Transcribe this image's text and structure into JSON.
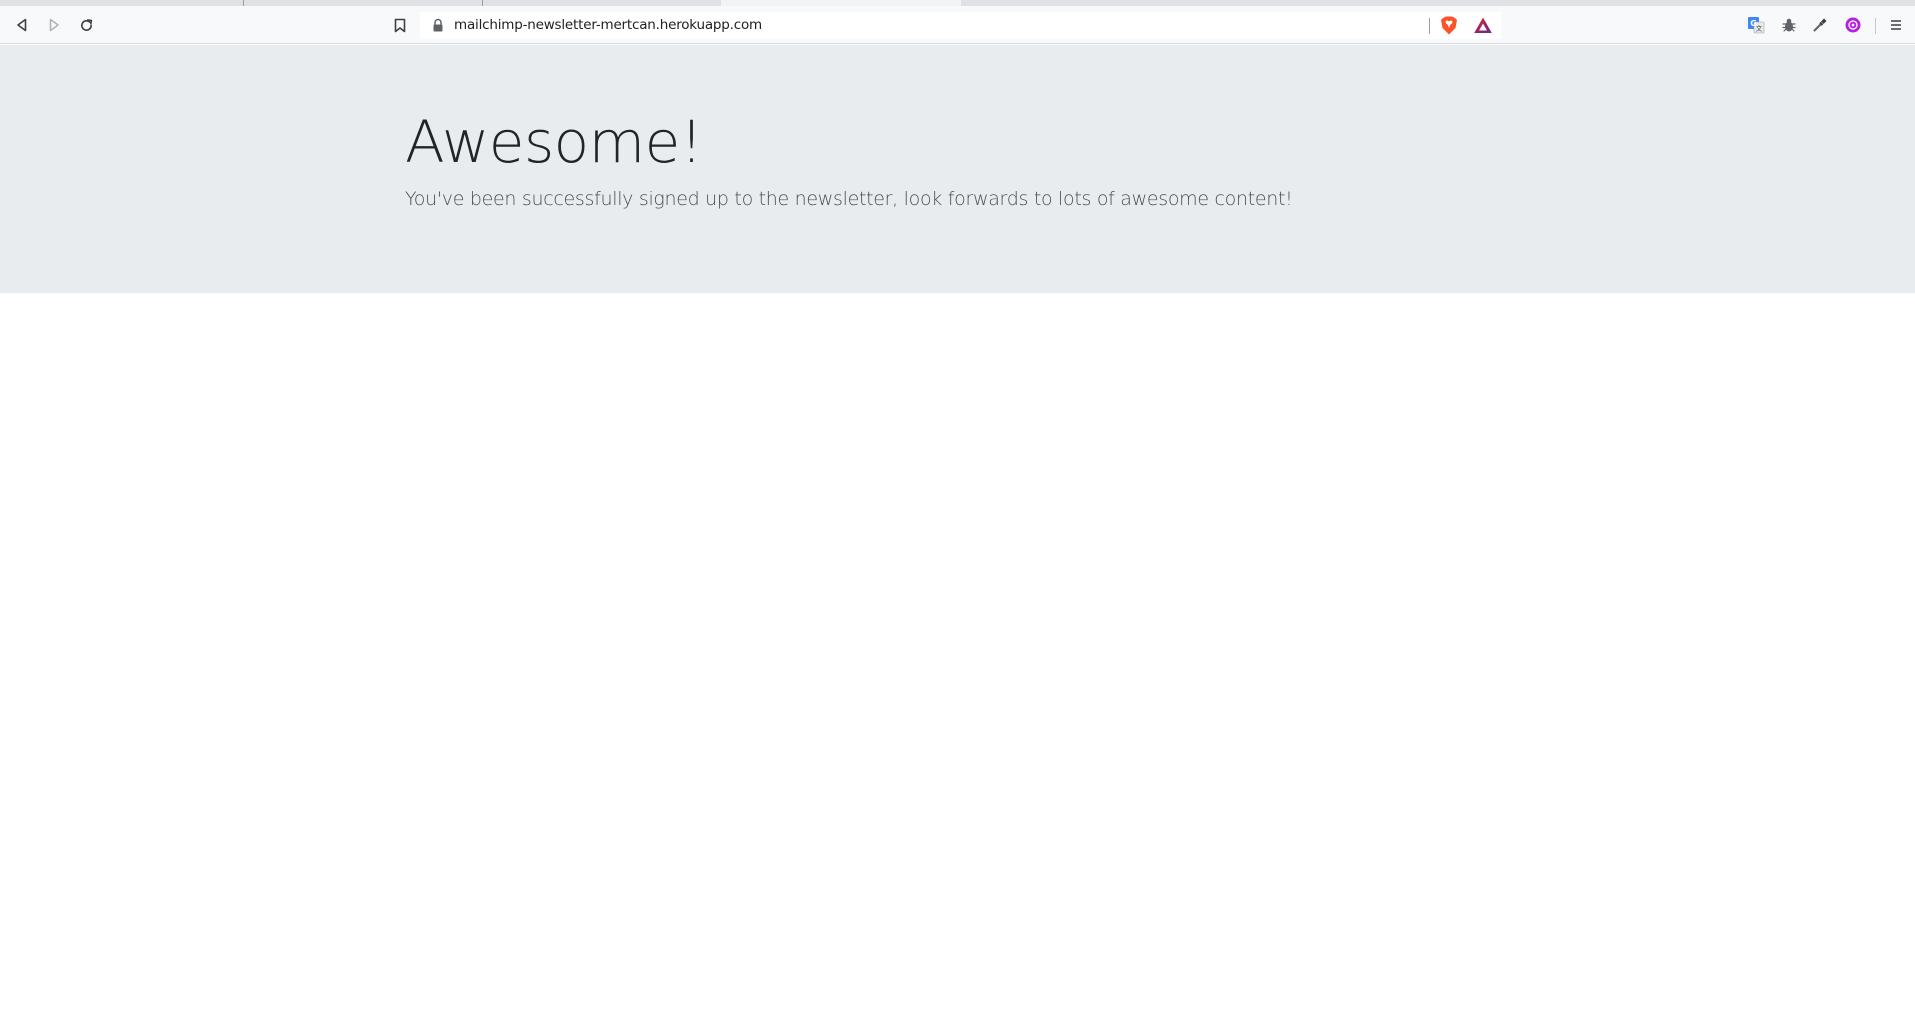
{
  "browser": {
    "url": "mailchimp-newsletter-mertcan.herokuapp.com",
    "icons": {
      "back": "back-arrow-icon",
      "forward": "forward-arrow-icon",
      "reload": "reload-icon",
      "bookmark": "bookmark-icon",
      "lock": "lock-icon",
      "shields": "brave-shield-icon",
      "rewards": "brave-rewards-icon",
      "translate": "translate-extension-icon",
      "bug": "bug-extension-icon",
      "picker": "color-picker-extension-icon",
      "profile": "profile-extension-icon",
      "menu": "hamburger-menu-icon"
    },
    "colors": {
      "shield_orange": "#fb542b",
      "rewards_purple": "#662d91",
      "rewards_red": "#ff4724",
      "translate_blue": "#4285f4",
      "profile_purple": "#b620e0"
    }
  },
  "page": {
    "title": "Awesome!",
    "lead": "You've been successfully signed up to the newsletter, look forwards to lots of awesome content!",
    "colors": {
      "jumbotron_bg": "#e9ecef",
      "text": "#212529"
    }
  }
}
